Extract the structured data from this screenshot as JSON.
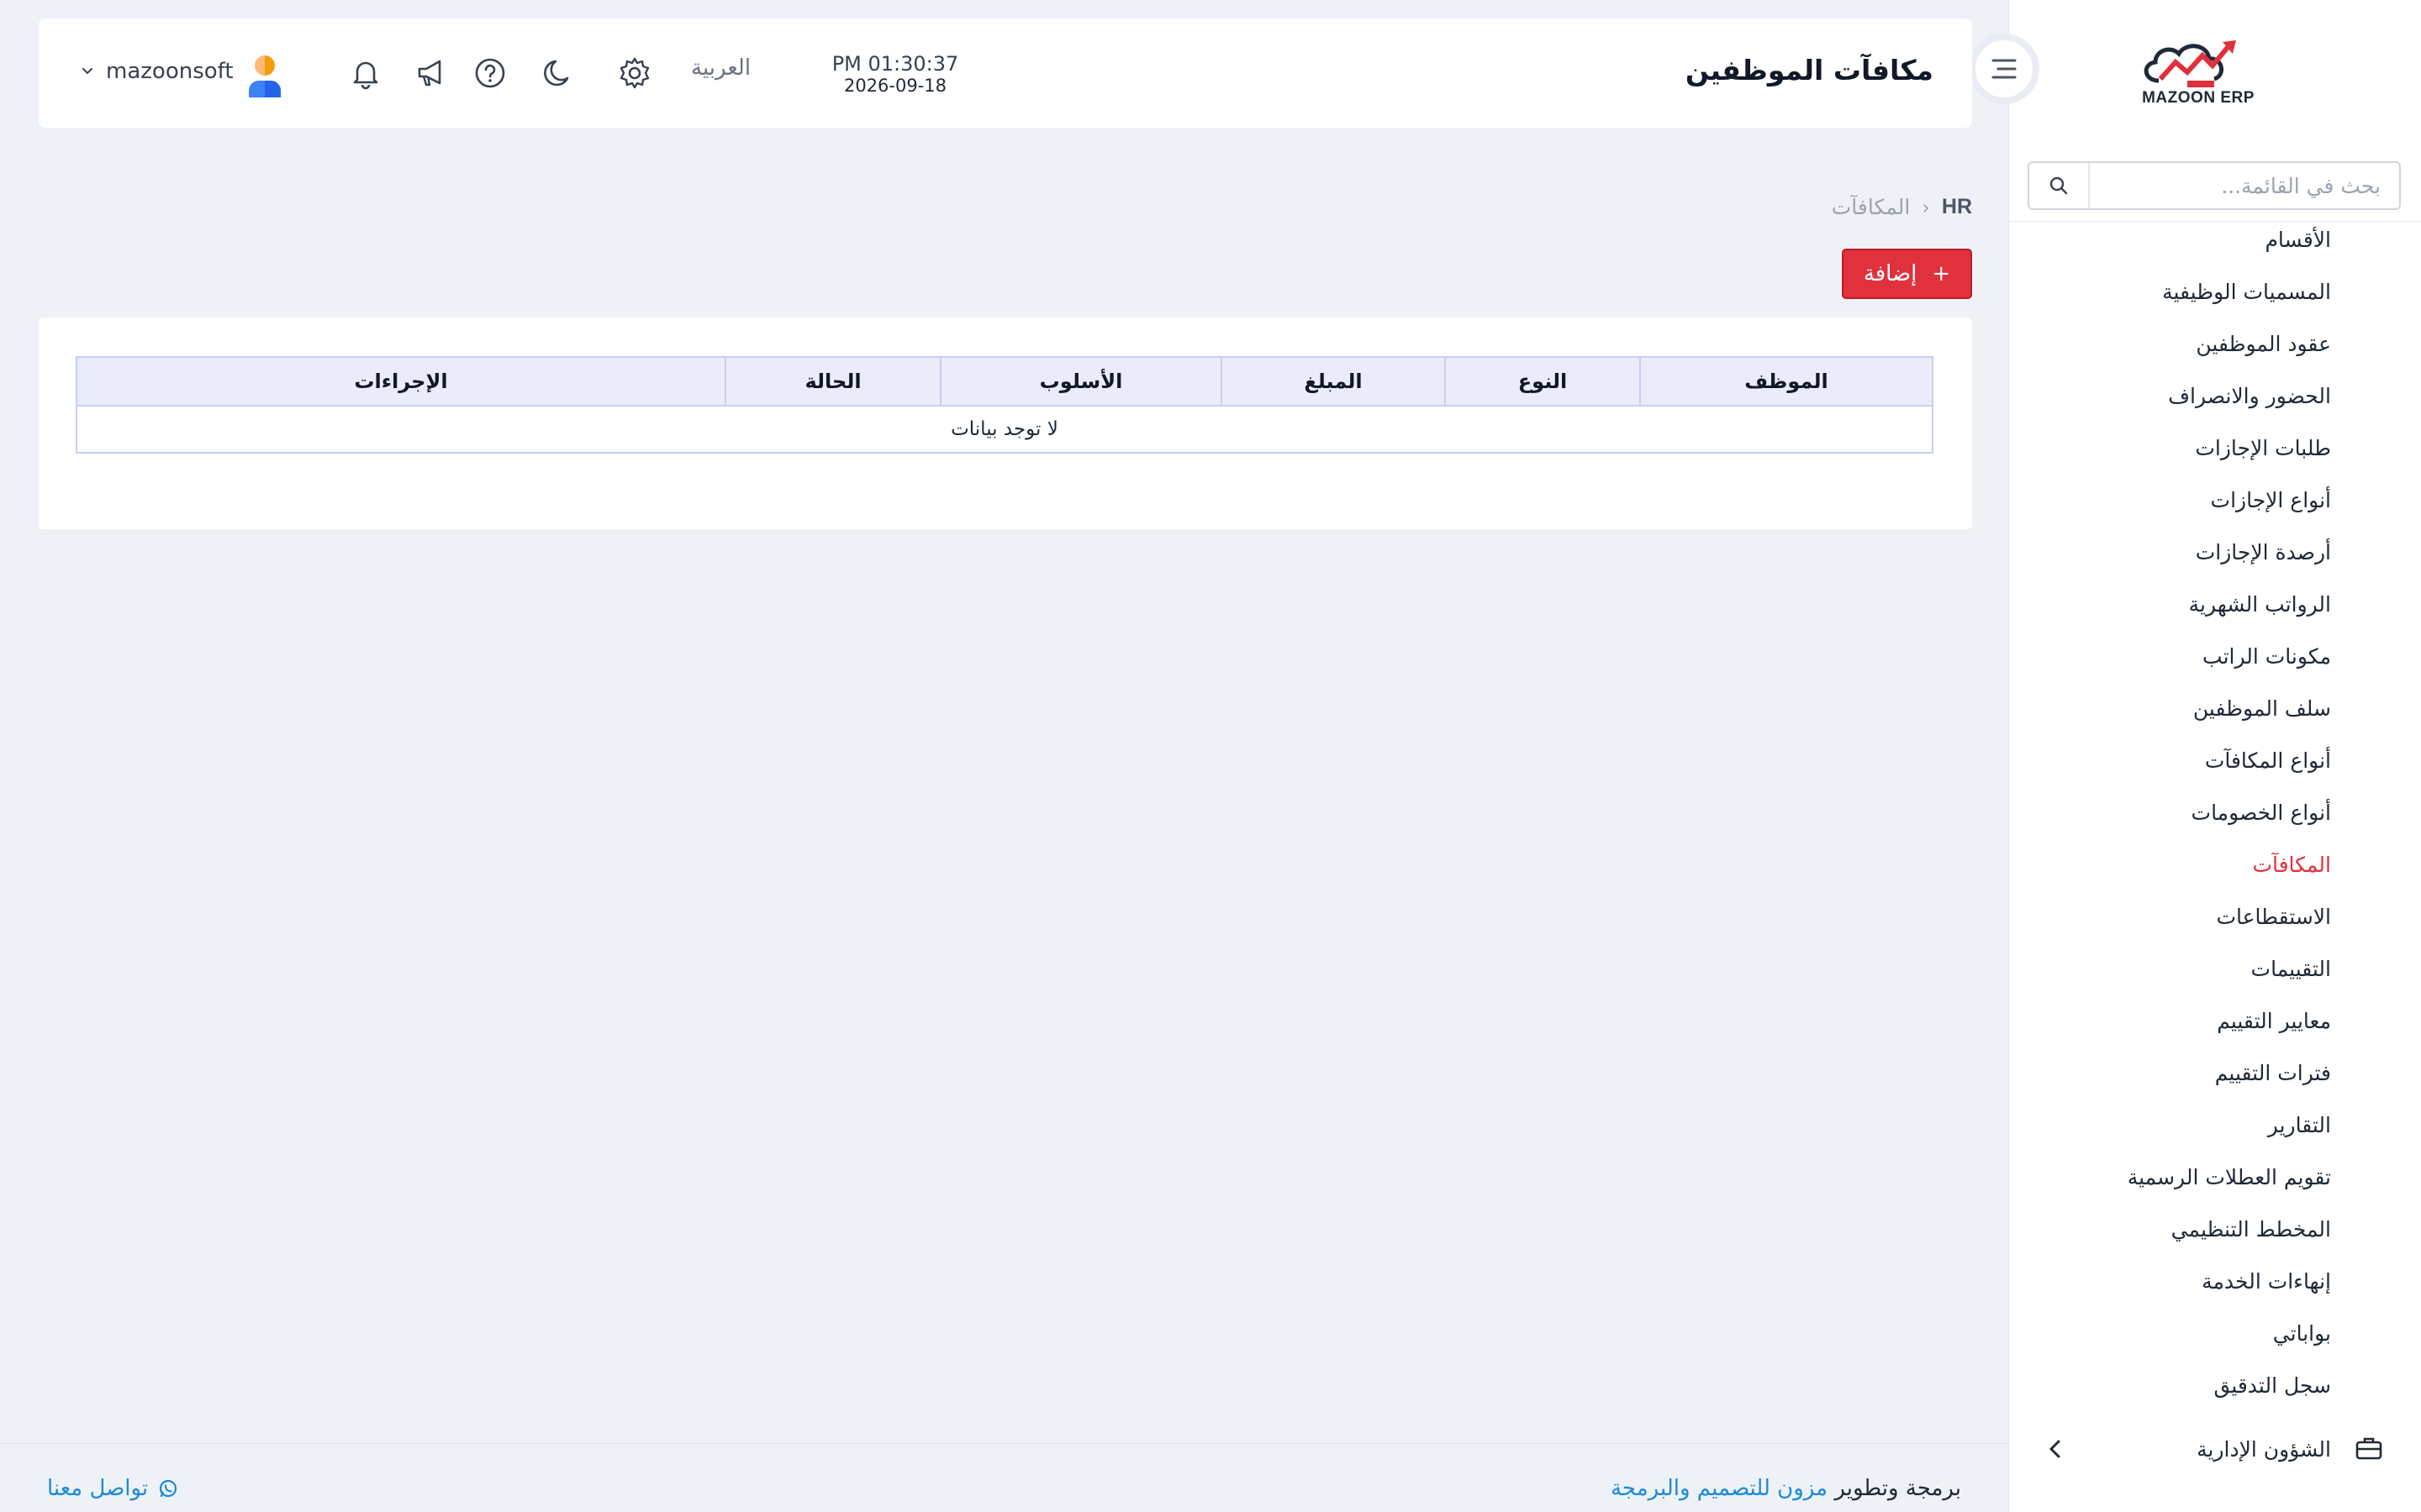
{
  "brand": {
    "logo_text": "MAZOON ERP"
  },
  "sidebar": {
    "search_placeholder": "بحث في القائمة...",
    "items": [
      {
        "label": "الأقسام",
        "active": false
      },
      {
        "label": "المسميات الوظيفية",
        "active": false
      },
      {
        "label": "عقود الموظفين",
        "active": false
      },
      {
        "label": "الحضور والانصراف",
        "active": false
      },
      {
        "label": "طلبات الإجازات",
        "active": false
      },
      {
        "label": "أنواع الإجازات",
        "active": false
      },
      {
        "label": "أرصدة الإجازات",
        "active": false
      },
      {
        "label": "الرواتب الشهرية",
        "active": false
      },
      {
        "label": "مكونات الراتب",
        "active": false
      },
      {
        "label": "سلف الموظفين",
        "active": false
      },
      {
        "label": "أنواع المكافآت",
        "active": false
      },
      {
        "label": "أنواع الخصومات",
        "active": false
      },
      {
        "label": "المكافآت",
        "active": true
      },
      {
        "label": "الاستقطاعات",
        "active": false
      },
      {
        "label": "التقييمات",
        "active": false
      },
      {
        "label": "معايير التقييم",
        "active": false
      },
      {
        "label": "فترات التقييم",
        "active": false
      },
      {
        "label": "التقارير",
        "active": false
      },
      {
        "label": "تقويم العطلات الرسمية",
        "active": false
      },
      {
        "label": "المخطط التنظيمي",
        "active": false
      },
      {
        "label": "إنهاءات الخدمة",
        "active": false
      },
      {
        "label": "بواباتي",
        "active": false
      },
      {
        "label": "سجل التدقيق",
        "active": false
      }
    ],
    "parent_section": {
      "label": "الشؤون الإدارية",
      "icon": "briefcase-icon"
    }
  },
  "header": {
    "title": "مكافآت الموظفين",
    "time": "PM 01:30:37",
    "date": "2026-09-18",
    "language": "العربية",
    "username": "mazoonsoft",
    "icons": [
      "settings-icon",
      "moon-icon",
      "help-icon",
      "megaphone-icon",
      "bell-icon",
      "avatar",
      "chevron-down-icon"
    ]
  },
  "breadcrumb": {
    "root": "HR",
    "current": "المكافآت"
  },
  "actions": {
    "add_label": "إضافة",
    "add_icon": "+"
  },
  "table": {
    "columns": [
      "الموظف",
      "النوع",
      "المبلغ",
      "الأسلوب",
      "الحالة",
      "الإجراءات"
    ],
    "empty_text": "لا توجد بيانات"
  },
  "footer": {
    "credit_prefix": "برمجة وتطوير",
    "credit_link": "مزون للتصميم والبرمجة",
    "contact_label": "تواصل معنا"
  },
  "colors": {
    "accent": "#e0313d",
    "link": "#1d8ad6",
    "table_header_bg": "#ebecfa",
    "page_bg": "#eef2f7"
  }
}
